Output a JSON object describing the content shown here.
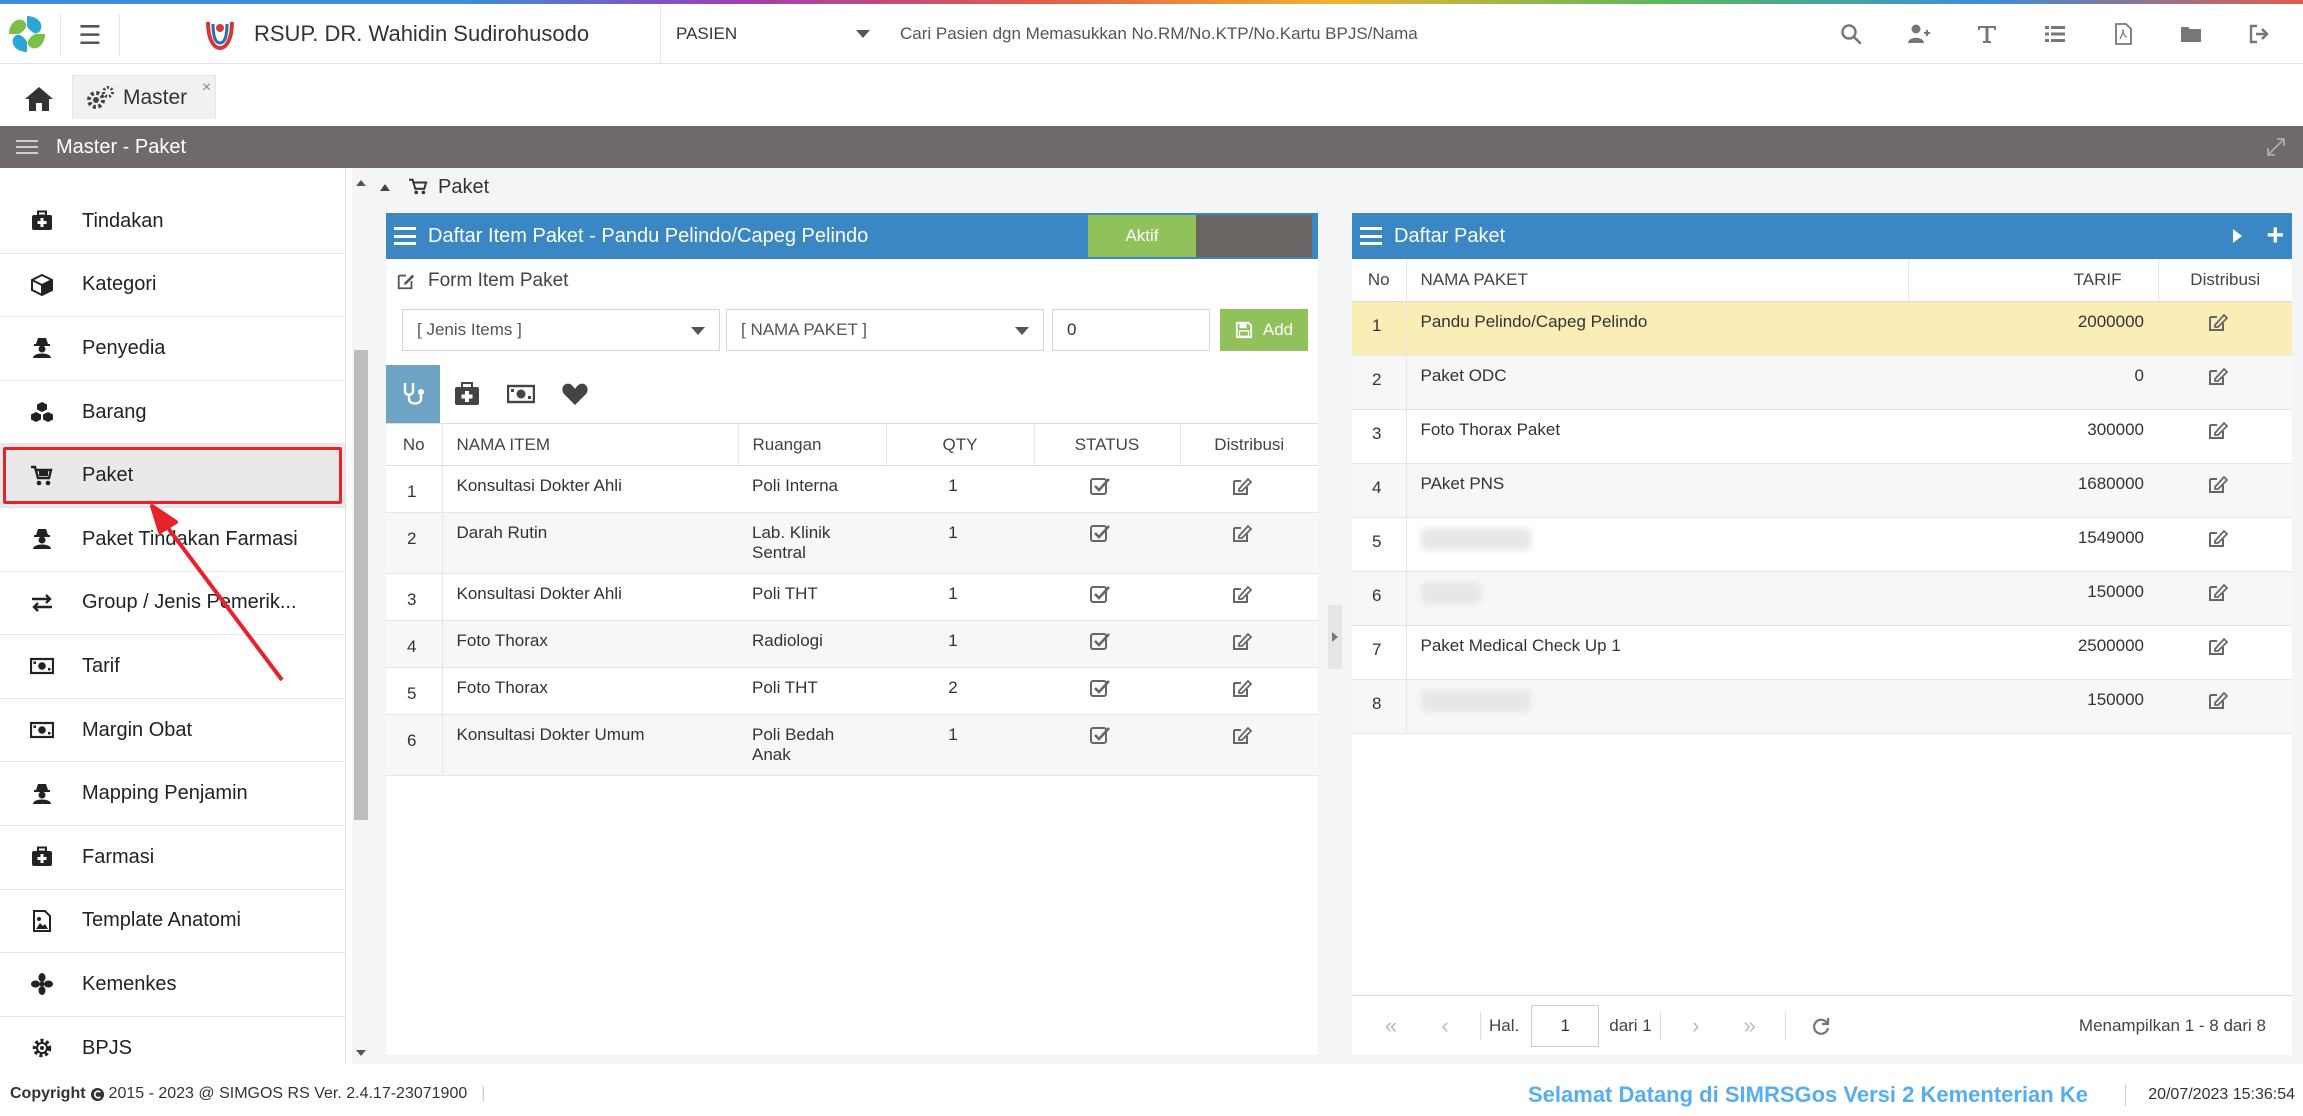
{
  "header": {
    "hospital_name": "RSUP. DR. Wahidin Sudirohusodo",
    "mode_select": "PASIEN",
    "search_placeholder": "Cari Pasien dgn Memasukkan No.RM/No.KTP/No.Kartu BPJS/Nama",
    "icons": [
      "search-icon",
      "add-user-icon",
      "text-icon",
      "list-icon",
      "pdf-icon",
      "folder-icon",
      "logout-icon"
    ]
  },
  "tabs": {
    "home": "home-icon",
    "master_label": "Master",
    "close": "×"
  },
  "section_title": "Master - Paket",
  "sidebar": {
    "items": [
      {
        "label": "Tindakan",
        "icon": "medkit-icon"
      },
      {
        "label": "Kategori",
        "icon": "cube-icon"
      },
      {
        "label": "Penyedia",
        "icon": "user-secret-icon"
      },
      {
        "label": "Barang",
        "icon": "cubes-icon"
      },
      {
        "label": "Paket",
        "icon": "cart-icon",
        "active": true
      },
      {
        "label": "Paket Tindakan Farmasi",
        "icon": "user-secret-icon"
      },
      {
        "label": "Group / Jenis Pemerik...",
        "icon": "exchange-icon"
      },
      {
        "label": "Tarif",
        "icon": "money-icon"
      },
      {
        "label": "Margin Obat",
        "icon": "money-icon"
      },
      {
        "label": "Mapping Penjamin",
        "icon": "user-secret-icon"
      },
      {
        "label": "Farmasi",
        "icon": "medkit-icon"
      },
      {
        "label": "Template Anatomi",
        "icon": "image-file-icon"
      },
      {
        "label": "Kemenkes",
        "icon": "flower-icon"
      },
      {
        "label": "BPJS",
        "icon": "gear-icon"
      }
    ]
  },
  "breadcrumb": "Paket",
  "left_panel": {
    "title": "Daftar Item Paket - Pandu Pelindo/Capeg Pelindo",
    "toggle_label": "Aktif",
    "form_title": "Form Item Paket",
    "jenis_placeholder": "[ Jenis Items ]",
    "paket_placeholder": "[ NAMA PAKET ]",
    "qty_value": "0",
    "add_label": "Add",
    "columns": [
      "No",
      "NAMA ITEM",
      "Ruangan",
      "QTY",
      "STATUS",
      "Distribusi"
    ],
    "rows": [
      {
        "no": "1",
        "item": "Konsultasi Dokter Ahli",
        "ruangan": "Poli Interna",
        "qty": "1"
      },
      {
        "no": "2",
        "item": "Darah Rutin",
        "ruangan": "Lab. Klinik Sentral",
        "qty": "1"
      },
      {
        "no": "3",
        "item": "Konsultasi Dokter Ahli",
        "ruangan": "Poli THT",
        "qty": "1"
      },
      {
        "no": "4",
        "item": "Foto Thorax",
        "ruangan": "Radiologi",
        "qty": "1"
      },
      {
        "no": "5",
        "item": "Foto Thorax",
        "ruangan": "Poli THT",
        "qty": "2"
      },
      {
        "no": "6",
        "item": "Konsultasi Dokter Umum",
        "ruangan": "Poli Bedah Anak",
        "qty": "1"
      }
    ]
  },
  "right_panel": {
    "title": "Daftar Paket",
    "columns": [
      "No",
      "NAMA PAKET",
      "TARIF",
      "Distribusi"
    ],
    "rows": [
      {
        "no": "1",
        "nama": "Pandu Pelindo/Capeg Pelindo",
        "tarif": "2000000",
        "selected": true
      },
      {
        "no": "2",
        "nama": "Paket ODC",
        "tarif": "0"
      },
      {
        "no": "3",
        "nama": "Foto Thorax Paket",
        "tarif": "300000"
      },
      {
        "no": "4",
        "nama": "PAket PNS",
        "tarif": "1680000"
      },
      {
        "no": "5",
        "nama": "",
        "tarif": "1549000",
        "blurred": true
      },
      {
        "no": "6",
        "nama": "",
        "tarif": "150000",
        "blurred": true
      },
      {
        "no": "7",
        "nama": "Paket Medical Check Up 1",
        "tarif": "2500000"
      },
      {
        "no": "8",
        "nama": "",
        "tarif": "150000",
        "blurred": true
      }
    ],
    "pager": {
      "hal_label": "Hal.",
      "page": "1",
      "of_label": "dari 1",
      "info": "Menampilkan 1 - 8 dari 8"
    }
  },
  "footer": {
    "copyright": "Copyright",
    "version": "2015 - 2023 @ SIMGOS RS Ver. 2.4.17-23071900",
    "marquee": "Selamat Datang di SIMRSGos Versi 2 Kementerian Ke",
    "datetime": "20/07/2023 15:36:54"
  },
  "colors": {
    "panel_header": "#3a87c4",
    "aktif_green": "#90c15b",
    "section_bar": "#6f6a69",
    "selected_row": "#fbedb6",
    "annotation_red": "#e8222a",
    "marquee_blue": "#56aef0"
  }
}
